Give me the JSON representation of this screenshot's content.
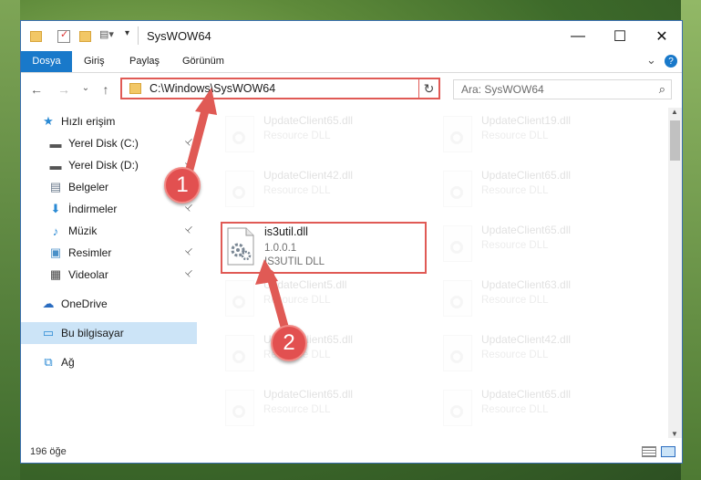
{
  "window": {
    "title": "SysWOW64",
    "minimize_glyph": "—",
    "maximize_glyph": "☐",
    "close_glyph": "✕"
  },
  "ribbon": {
    "tabs": [
      "Dosya",
      "Giriş",
      "Paylaş",
      "Görünüm"
    ],
    "collapse_glyph": "⌄",
    "help_glyph": "?"
  },
  "navigation": {
    "back_glyph": "←",
    "forward_glyph": "→",
    "recent_glyph": "⌄",
    "up_glyph": "↑",
    "address": "C:\\Windows\\SysWOW64",
    "address_dropdown_glyph": "⌄",
    "refresh_glyph": "↻",
    "search_placeholder": "Ara: SysWOW64",
    "search_glyph": "⌕"
  },
  "sidebar": {
    "items": [
      {
        "label": "Hızlı erişim",
        "icon": "star-icon",
        "glyph": "★",
        "color": "#2a8ad4",
        "pinned": false
      },
      {
        "label": "Yerel Disk (C:)",
        "icon": "drive-icon",
        "glyph": "▬",
        "color": "#555555",
        "pinned": true
      },
      {
        "label": "Yerel Disk (D:)",
        "icon": "drive-icon",
        "glyph": "▬",
        "color": "#555555",
        "pinned": true
      },
      {
        "label": "Belgeler",
        "icon": "documents-icon",
        "glyph": "▤",
        "color": "#6b7a8c",
        "pinned": true
      },
      {
        "label": "İndirmeler",
        "icon": "download-icon",
        "glyph": "⬇",
        "color": "#2a8ad4",
        "pinned": true
      },
      {
        "label": "Müzik",
        "icon": "music-icon",
        "glyph": "♪",
        "color": "#2a8ad4",
        "pinned": true
      },
      {
        "label": "Resimler",
        "icon": "pictures-icon",
        "glyph": "▣",
        "color": "#4a90c8",
        "pinned": true
      },
      {
        "label": "Videolar",
        "icon": "video-icon",
        "glyph": "▦",
        "color": "#444444",
        "pinned": true
      },
      {
        "label": "OneDrive",
        "icon": "cloud-icon",
        "glyph": "☁",
        "color": "#2a6cc0",
        "pinned": false
      },
      {
        "label": "Bu bilgisayar",
        "icon": "computer-icon",
        "glyph": "▭",
        "color": "#2a8ad4",
        "pinned": false
      },
      {
        "label": "Ağ",
        "icon": "network-icon",
        "glyph": "⧉",
        "color": "#2a8ad4",
        "pinned": false
      }
    ],
    "pin_glyph": "📌"
  },
  "files": [
    {
      "name": "UpdateClient65.dll",
      "type": "Resource DLL"
    },
    {
      "name": "UpdateClient19.dll",
      "type": "Resource DLL"
    },
    {
      "name": "UpdateClient42.dll",
      "type": "Resource DLL"
    },
    {
      "name": "UpdateClient65.dll",
      "type": "Resource DLL"
    },
    {
      "name": "UpdateClient65.dll",
      "type": "Resource DLL"
    },
    {
      "name": "UpdateClient5.dll",
      "type": "Resource DLL"
    },
    {
      "name": "UpdateClient63.dll",
      "type": "Resource DLL"
    },
    {
      "name": "UpdateClient65.dll",
      "type": "Resource DLL"
    },
    {
      "name": "UpdateClient42.dll",
      "type": "Resource DLL"
    },
    {
      "name": "UpdateClient65.dll",
      "type": "Resource DLL"
    },
    {
      "name": "UpdateClient65.dll",
      "type": "Resource DLL"
    }
  ],
  "highlighted_file": {
    "name": "is3util.dll",
    "version": "1.0.0.1",
    "description": "IS3UTIL DLL"
  },
  "status": {
    "item_count": "196 öğe"
  },
  "annotations": {
    "step1": "1",
    "step2": "2",
    "color": "#e05a55"
  }
}
